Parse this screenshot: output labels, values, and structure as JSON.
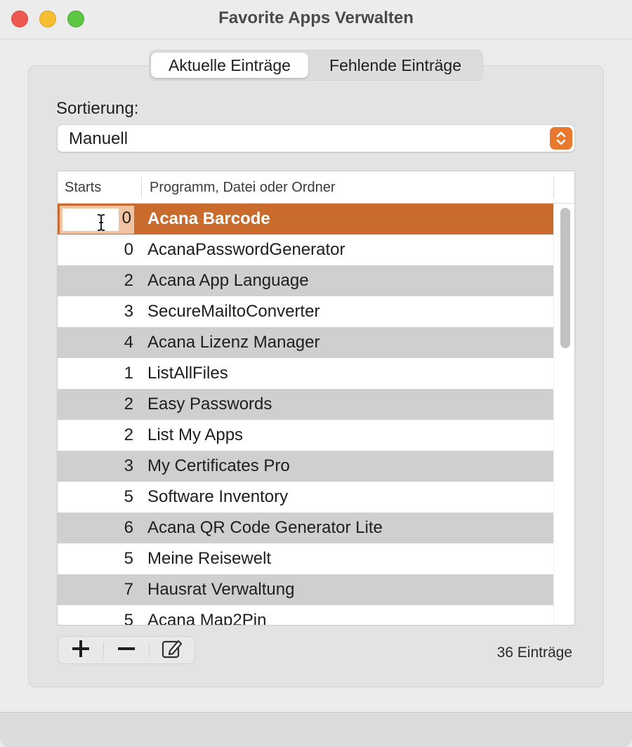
{
  "window": {
    "title": "Favorite Apps Verwalten"
  },
  "tabs": [
    {
      "label": "Aktuelle Einträge",
      "selected": true
    },
    {
      "label": "Fehlende Einträge",
      "selected": false
    }
  ],
  "sort": {
    "label": "Sortierung:",
    "value": "Manuell"
  },
  "table": {
    "columns": [
      "Starts",
      "Programm, Datei oder Ordner"
    ],
    "rows": [
      {
        "starts": "0",
        "name": "Acana Barcode",
        "selected": true,
        "editing": true
      },
      {
        "starts": "0",
        "name": "AcanaPasswordGenerator"
      },
      {
        "starts": "2",
        "name": "Acana App Language"
      },
      {
        "starts": "3",
        "name": "SecureMailtoConverter"
      },
      {
        "starts": "4",
        "name": "Acana Lizenz Manager"
      },
      {
        "starts": "1",
        "name": "ListAllFiles"
      },
      {
        "starts": "2",
        "name": "Easy Passwords"
      },
      {
        "starts": "2",
        "name": "List My Apps"
      },
      {
        "starts": "3",
        "name": "My Certificates Pro"
      },
      {
        "starts": "5",
        "name": "Software Inventory"
      },
      {
        "starts": "6",
        "name": "Acana QR Code Generator Lite"
      },
      {
        "starts": "5",
        "name": "Meine Reisewelt"
      },
      {
        "starts": "7",
        "name": "Hausrat Verwaltung"
      },
      {
        "starts": "5",
        "name": "Acana Map2Pin"
      }
    ]
  },
  "toolbar": {
    "add_icon": "plus-icon",
    "remove_icon": "minus-icon",
    "edit_icon": "edit-pencil-icon"
  },
  "status": {
    "count_text": "36 Einträge"
  },
  "colors": {
    "accent": "#c96b2d",
    "select_arrow": "#e9792f",
    "stripe": "#cfcfcf"
  }
}
